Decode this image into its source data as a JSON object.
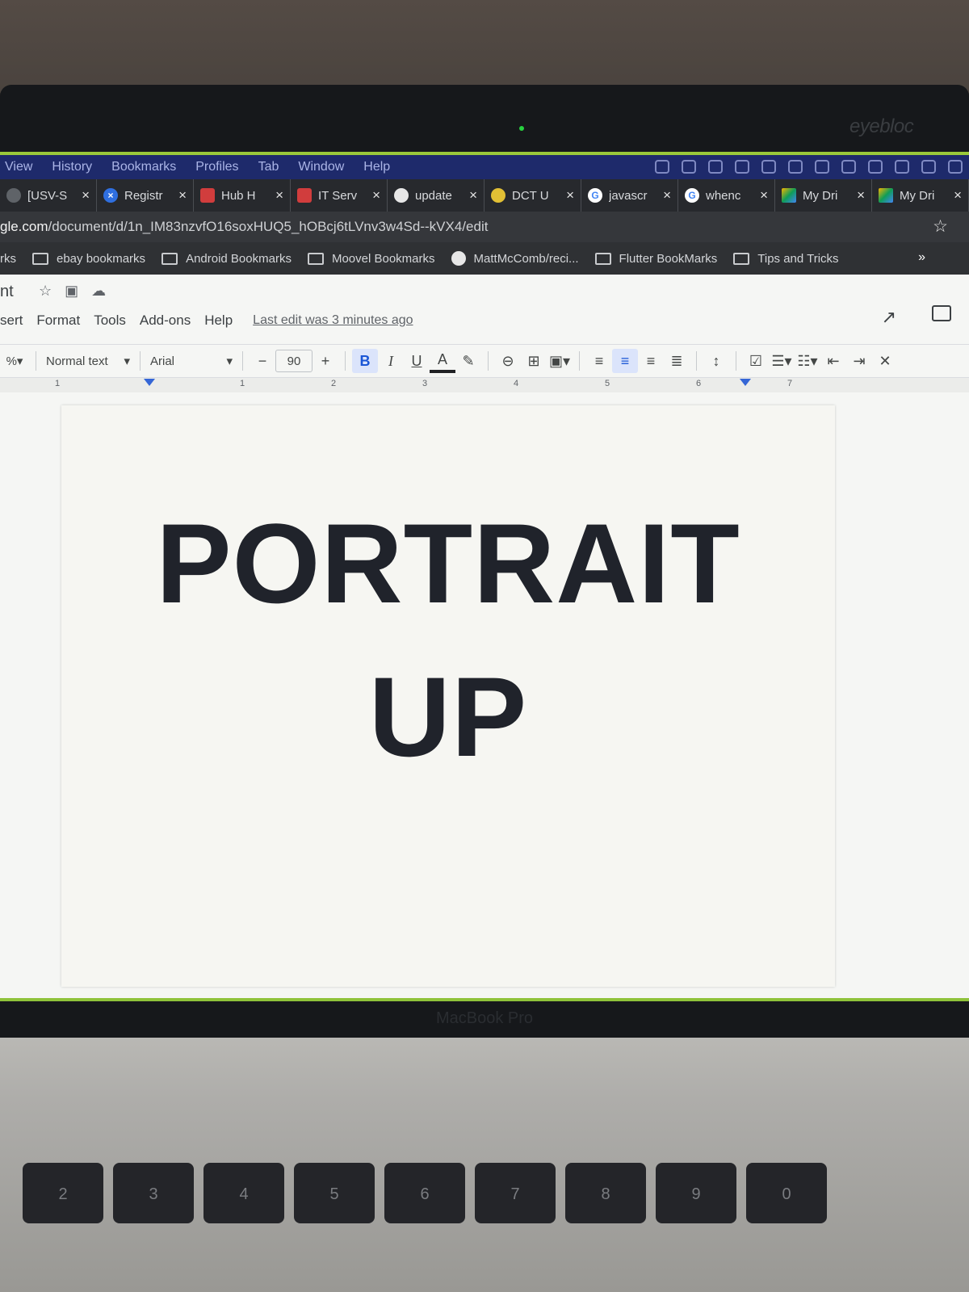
{
  "macos_menubar": {
    "items": [
      "View",
      "History",
      "Bookmarks",
      "Profiles",
      "Tab",
      "Window",
      "Help"
    ]
  },
  "tabs": [
    {
      "title": "[USV-S",
      "icon": "document-icon"
    },
    {
      "title": "Registr",
      "icon": "jira-icon"
    },
    {
      "title": "Hub H",
      "icon": "briefcase-icon"
    },
    {
      "title": "IT Serv",
      "icon": "briefcase-icon"
    },
    {
      "title": "update",
      "icon": "github-icon"
    },
    {
      "title": "DCT U",
      "icon": "trophy-icon"
    },
    {
      "title": "javascr",
      "icon": "google-icon"
    },
    {
      "title": "whenc",
      "icon": "google-icon"
    },
    {
      "title": "My Dri",
      "icon": "drive-icon"
    },
    {
      "title": "My Dri",
      "icon": "drive-icon"
    }
  ],
  "url": {
    "host": "gle.com",
    "path": "/document/d/1n_IM83nzvfO16soxHUQ5_hOBcj6tLVnv3w4Sd--kVX4/edit"
  },
  "bookmarks": {
    "items": [
      {
        "label": "rks",
        "type": "folder-partial"
      },
      {
        "label": "ebay bookmarks",
        "type": "folder"
      },
      {
        "label": "Android Bookmarks",
        "type": "folder"
      },
      {
        "label": "Moovel Bookmarks",
        "type": "folder"
      },
      {
        "label": "MattMcComb/reci...",
        "type": "github"
      },
      {
        "label": "Flutter BookMarks",
        "type": "folder"
      },
      {
        "label": "Tips and Tricks",
        "type": "folder"
      }
    ],
    "more": "»"
  },
  "docs": {
    "title": "nt",
    "menu": [
      "sert",
      "Format",
      "Tools",
      "Add-ons",
      "Help"
    ],
    "last_edit": "Last edit was 3 minutes ago",
    "toolbar": {
      "zoom": "%",
      "style": "Normal text",
      "font": "Arial",
      "minus": "−",
      "size": "90",
      "plus": "+",
      "bold": "B",
      "italic": "I",
      "underline": "U",
      "text_color": "A"
    },
    "ruler_marks": [
      "1",
      "1",
      "2",
      "3",
      "4",
      "5",
      "6",
      "7"
    ],
    "content": {
      "line1": "PORTRAIT",
      "line2": "UP"
    }
  },
  "hardware": {
    "logo": "eyebloc",
    "laptop_brand": "MacBook Pro"
  },
  "keyboard": {
    "keys": [
      "2",
      "3",
      "4",
      "5",
      "6",
      "7",
      "8",
      "9",
      "0"
    ]
  },
  "colors": {
    "accent_green": "#9ac93a",
    "menu_blue": "#1e2a6b",
    "docs_blue": "#1a56d6",
    "page_bg": "#f6f6f2",
    "text_dark": "#20232b"
  }
}
